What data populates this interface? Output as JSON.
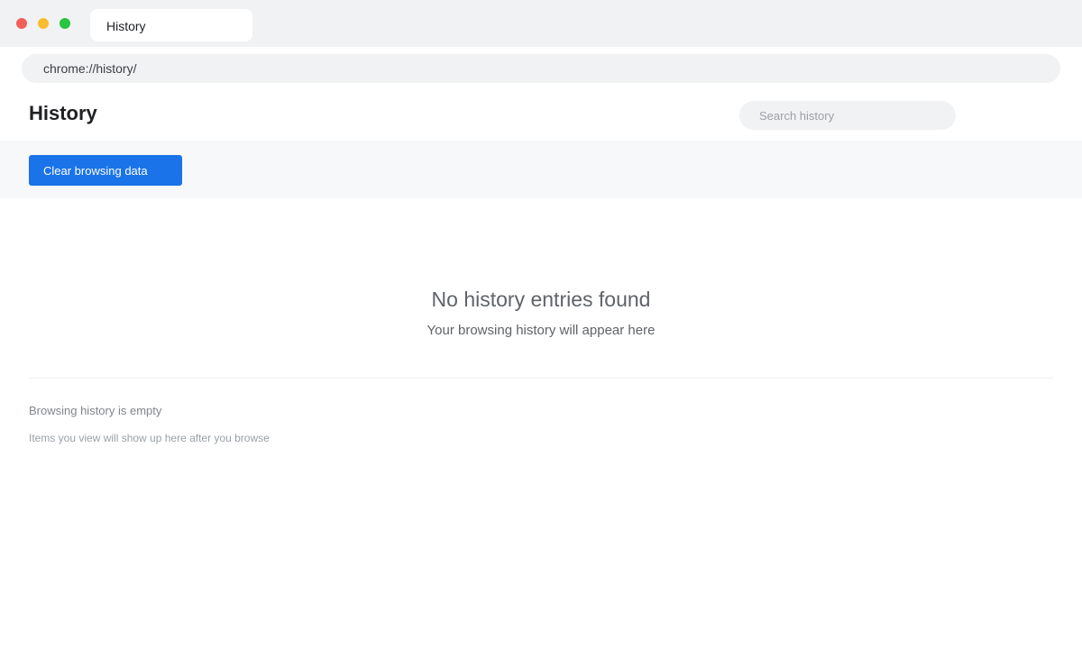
{
  "window": {
    "tab_title": "History"
  },
  "address_bar": {
    "url": "chrome://history/"
  },
  "page": {
    "title": "History",
    "search": {
      "placeholder": "Search history",
      "value": ""
    },
    "clear_button_label": "Clear browsing data"
  },
  "empty_state": {
    "title": "No history entries found",
    "subtitle": "Your browsing history will appear here"
  },
  "footer_note": {
    "title": "Browsing history is empty",
    "detail": "Items you view will show up here after you browse"
  },
  "colors": {
    "accent": "#1a73e8",
    "traffic_close": "#f25f58",
    "traffic_minimize": "#fbbd2f",
    "traffic_maximize": "#29c440"
  }
}
